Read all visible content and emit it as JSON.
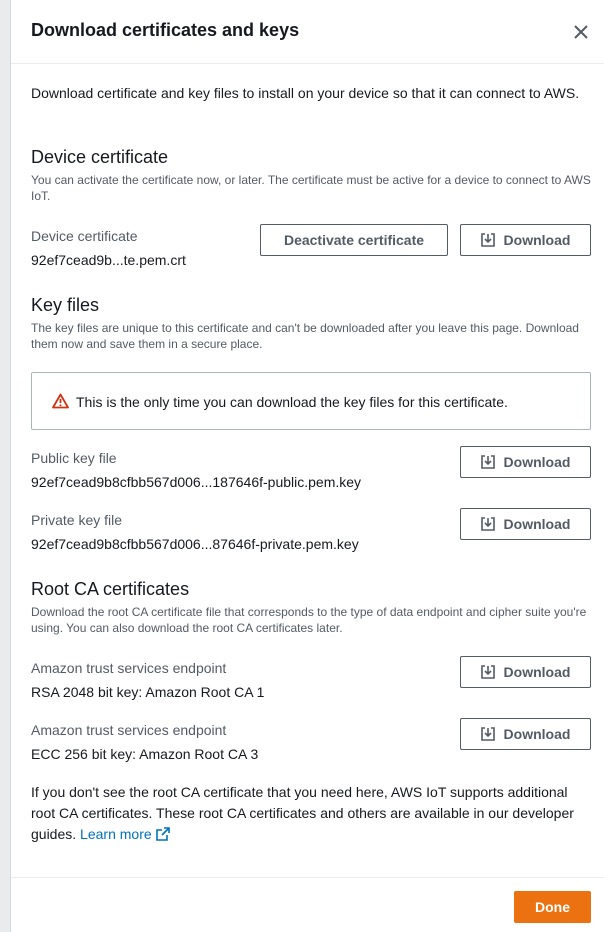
{
  "modal": {
    "title": "Download certificates and keys",
    "intro": "Download certificate and key files to install on your device so that it can connect to AWS."
  },
  "device_certificate": {
    "heading": "Device certificate",
    "description": "You can activate the certificate now, or later. The certificate must be active for a device to connect to AWS IoT.",
    "label": "Device certificate",
    "value": "92ef7cead9b...te.pem.crt",
    "deactivate_label": "Deactivate certificate",
    "download_label": "Download"
  },
  "key_files": {
    "heading": "Key files",
    "description": "The key files are unique to this certificate and can't be downloaded after you leave this page. Download them now and save them in a secure place.",
    "alert": "This is the only time you can download the key files for this certificate.",
    "public_label": "Public key file",
    "public_value": "92ef7cead9b8cfbb567d006...187646f-public.pem.key",
    "private_label": "Private key file",
    "private_value": "92ef7cead9b8cfbb567d006...87646f-private.pem.key",
    "download_label": "Download"
  },
  "root_ca": {
    "heading": "Root CA certificates",
    "description": "Download the root CA certificate file that corresponds to the type of data endpoint and cipher suite you're using. You can also download the root CA certificates later.",
    "items": [
      {
        "label": "Amazon trust services endpoint",
        "value": "RSA 2048 bit key: Amazon Root CA 1"
      },
      {
        "label": "Amazon trust services endpoint",
        "value": "ECC 256 bit key: Amazon Root CA 3"
      }
    ],
    "download_label": "Download",
    "note": "If you don't see the root CA certificate that you need here, AWS IoT supports additional root CA certificates. These root CA certificates and others are available in our developer guides.",
    "learn_more": "Learn more"
  },
  "footer": {
    "done_label": "Done"
  },
  "colors": {
    "primary": "#ec7211",
    "link": "#0073bb",
    "warning": "#d13212"
  },
  "icons": [
    "close-icon",
    "download-icon",
    "warning-icon",
    "external-link-icon"
  ]
}
